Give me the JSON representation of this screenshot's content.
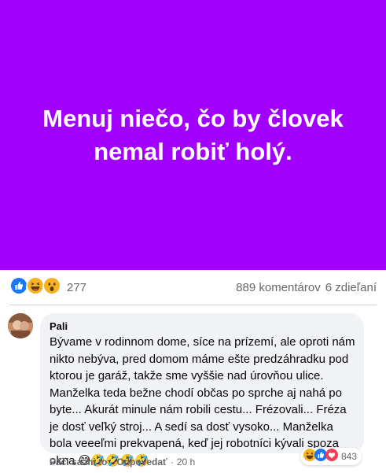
{
  "post": {
    "banner_text": "Menuj niečo, čo by človek nemal robiť holý.",
    "banner_color": "#a100ff"
  },
  "stats": {
    "reactions_count": "277",
    "comments": "889 komentárov",
    "shares": "6 zdieľaní",
    "reaction_icons": [
      "like-icon",
      "haha-icon",
      "wow-icon"
    ]
  },
  "comment": {
    "author": "Pali",
    "text": "Bývame v rodinnom dome, síce na prízemí, ale oproti nám nikto nebýva, pred domom máme ešte predzáhradku pod ktorou je garáž, takže sme vyššie nad úrovňou ulice. Manželka teda bežne chodí občas po sprche aj nahá po byte... Akurát minule nám robili cestu... Frézovali... Fréza je dosť veľký stroj... A sedí sa dosť vysoko... Manželka bola veeeľmi prekvapená, keď jej robotníci kývali spoza okna",
    "emojis": "😅🤣🤣🤣🤣",
    "reactions_count": "843",
    "reaction_icons": [
      "haha-icon",
      "like-icon",
      "love-icon"
    ],
    "like_action": "Páči sa mi to",
    "reply_action": "Odpovedať",
    "separator": "·",
    "time": "20 h"
  }
}
